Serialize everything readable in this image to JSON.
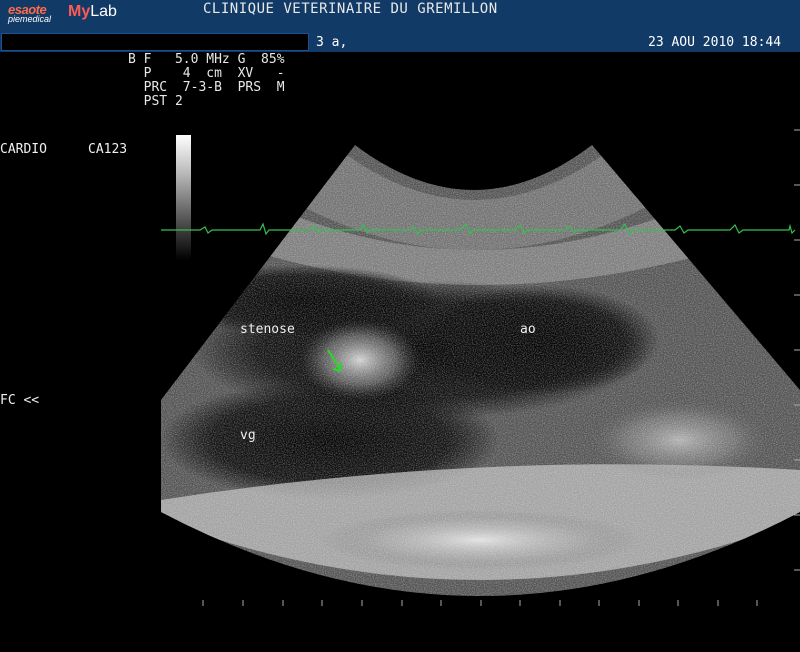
{
  "header": {
    "brand": "esaote",
    "brand_sub": "piemedical",
    "product_my": "My",
    "product_lab": "Lab",
    "clinic": "CLINIQUE VETERINAIRE DU GREMILLON",
    "age": "3 a,",
    "datetime": "23 AOU 2010 18:44"
  },
  "params": {
    "line1": "B F   5.0 MHz G  85%",
    "line2": "  P    4  cm  XV   -",
    "line3": "  PRC  7-3-B  PRS  M",
    "line4": "  PST 2"
  },
  "left_labels": {
    "mode": "CARDIO",
    "probe": "CA123",
    "fc": "FC <<"
  },
  "annotations": {
    "stenose": "stenose",
    "ao": "ao",
    "vg": "vg"
  },
  "colors": {
    "header_bg": "#123a66",
    "ecg_trace": "#35c050",
    "arrow": "#22dd22"
  }
}
